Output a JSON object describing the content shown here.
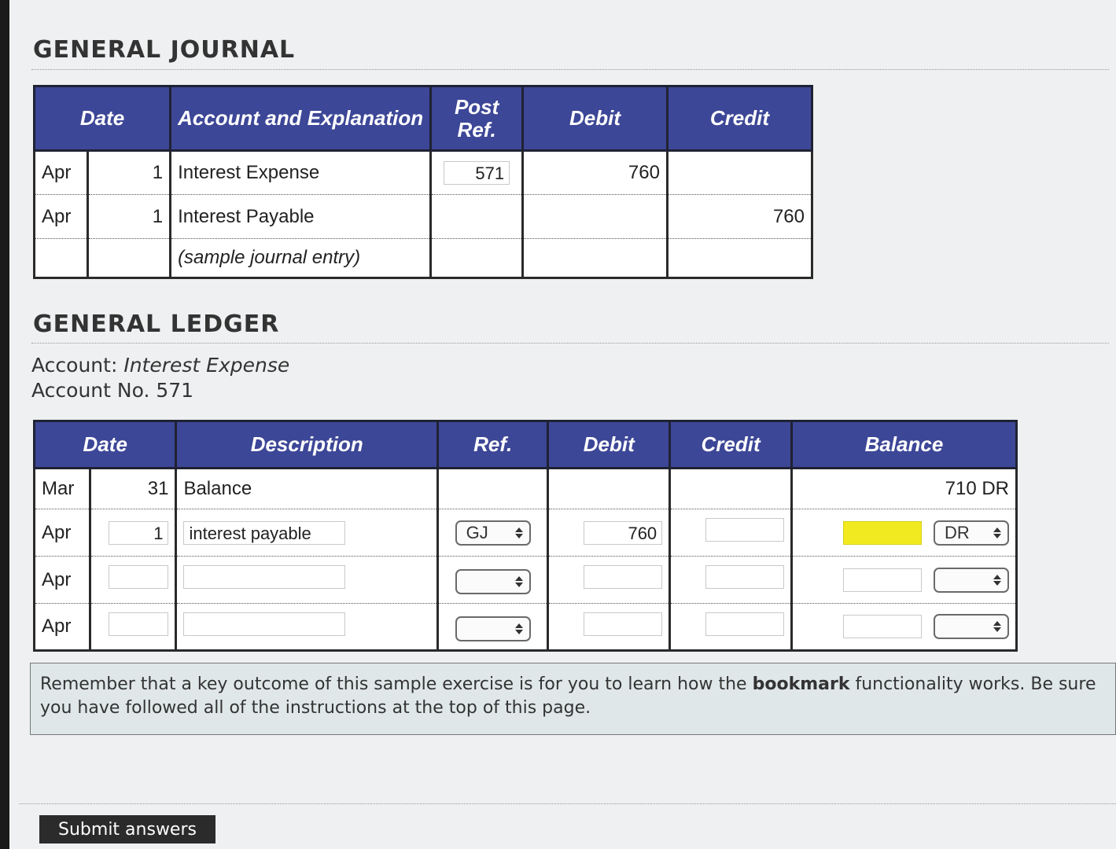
{
  "journal": {
    "title": "GENERAL JOURNAL",
    "headers": {
      "date": "Date",
      "account": "Account and Explanation",
      "post_ref": "Post Ref.",
      "debit": "Debit",
      "credit": "Credit"
    },
    "rows": [
      {
        "month": "Apr",
        "day": "1",
        "account": "Interest Expense",
        "post_ref": "571",
        "debit": "760",
        "credit": ""
      },
      {
        "month": "Apr",
        "day": "1",
        "account": "Interest Payable",
        "post_ref": "",
        "debit": "",
        "credit": "760"
      },
      {
        "month": "",
        "day": "",
        "account": "(sample journal entry)",
        "post_ref": "",
        "debit": "",
        "credit": ""
      }
    ]
  },
  "ledger": {
    "title": "GENERAL LEDGER",
    "account_label": "Account:",
    "account_name": "Interest Expense",
    "account_no_label": "Account No.",
    "account_no": "571",
    "headers": {
      "date": "Date",
      "description": "Description",
      "ref": "Ref.",
      "debit": "Debit",
      "credit": "Credit",
      "balance": "Balance"
    },
    "rows": [
      {
        "month": "Mar",
        "day": "31",
        "description": "Balance",
        "ref": "",
        "debit": "",
        "credit": "",
        "balance": "710 DR",
        "balance_type": ""
      },
      {
        "month": "Apr",
        "day": "1",
        "description": "interest payable",
        "ref": "GJ",
        "debit": "760",
        "credit": "",
        "balance": "",
        "balance_type": "DR"
      },
      {
        "month": "Apr",
        "day": "",
        "description": "",
        "ref": "",
        "debit": "",
        "credit": "",
        "balance": "",
        "balance_type": ""
      },
      {
        "month": "Apr",
        "day": "",
        "description": "",
        "ref": "",
        "debit": "",
        "credit": "",
        "balance": "",
        "balance_type": ""
      }
    ]
  },
  "notice": {
    "before": "Remember that a key outcome of this sample exercise is for you to learn how the",
    "bold": "bookmark",
    "after": "functionality works. Be sure you have followed all of the instructions at the top of this page."
  },
  "submit_label": "Submit answers",
  "colors": {
    "header_bg": "#3d4797",
    "highlight": "#f2ea20",
    "notice_bg": "#dfe7e8"
  }
}
